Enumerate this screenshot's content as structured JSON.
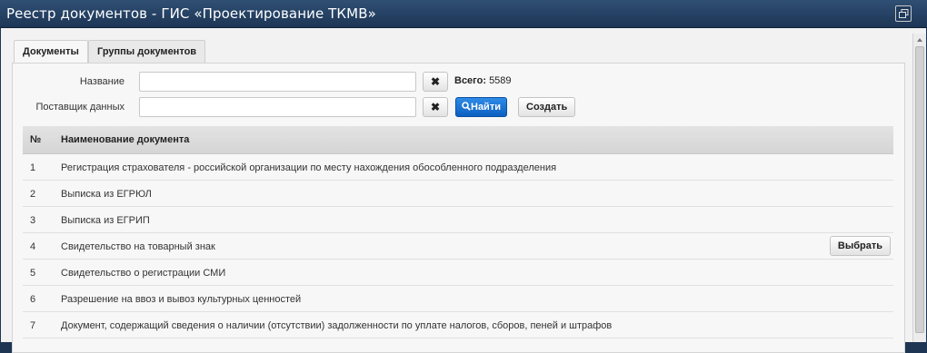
{
  "window": {
    "title": "Реестр документов - ГИС «Проектирование ТКМВ»",
    "restore_icon": "restore-window-icon"
  },
  "tabs": [
    {
      "label": "Документы",
      "active": true
    },
    {
      "label": "Группы документов",
      "active": false
    }
  ],
  "filters": {
    "name_label": "Название",
    "name_value": "",
    "provider_label": "Поставщик данных",
    "provider_value": "",
    "clear_symbol": "✖",
    "total_label": "Всего:",
    "total_value": "5589",
    "find_label": "Найти",
    "create_label": "Создать"
  },
  "table": {
    "columns": [
      "№",
      "Наименование документа"
    ],
    "rows": [
      {
        "num": "1",
        "name": "Регистрация страхователя - российской организации по месту нахождения обособленного подразделения"
      },
      {
        "num": "2",
        "name": "Выписка из ЕГРЮЛ"
      },
      {
        "num": "3",
        "name": "Выписка из ЕГРИП"
      },
      {
        "num": "4",
        "name": "Свидетельство на товарный знак"
      },
      {
        "num": "5",
        "name": "Свидетельство о регистрации СМИ"
      },
      {
        "num": "6",
        "name": "Разрешение на ввоз и вывоз культурных ценностей"
      },
      {
        "num": "7",
        "name": "Документ, содержащий сведения о наличии (отсутствии) задолженности по уплате налогов, сборов, пеней и штрафов"
      }
    ],
    "select_label": "Выбрать"
  }
}
